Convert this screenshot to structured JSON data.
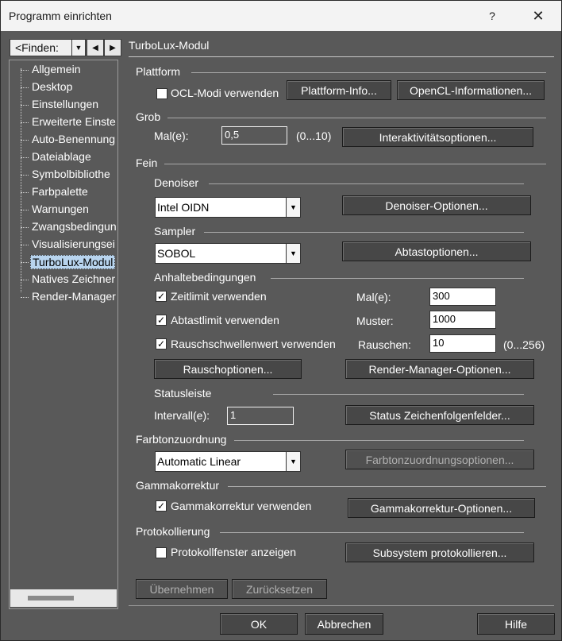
{
  "window": {
    "title": "Programm einrichten",
    "help_glyph": "?",
    "close_glyph": "✕"
  },
  "left": {
    "finder_value": "<Finden:",
    "tree": [
      {
        "label": "Allgemein"
      },
      {
        "label": "Desktop"
      },
      {
        "label": "Einstellungen"
      },
      {
        "label": "Erweiterte Einste"
      },
      {
        "label": "Auto-Benennung"
      },
      {
        "label": "Dateiablage"
      },
      {
        "label": "Symbolbibliothe"
      },
      {
        "label": "Farbpalette"
      },
      {
        "label": "Warnungen"
      },
      {
        "label": "Zwangsbedingun"
      },
      {
        "label": "Visualisierungsei"
      },
      {
        "label": "TurboLux-Modul",
        "selected": true
      },
      {
        "label": "Natives Zeichner"
      },
      {
        "label": "Render-Manager"
      }
    ]
  },
  "panel": {
    "title": "TurboLux-Modul",
    "plattform": {
      "heading": "Plattform",
      "ocl_checkbox": {
        "label": "OCL-Modi verwenden",
        "checked": false
      },
      "platform_info_btn": "Plattform-Info...",
      "opencl_info_btn": "OpenCL-Informationen..."
    },
    "grob": {
      "heading": "Grob",
      "mal_label": "Mal(e):",
      "mal_value": "0,5",
      "range": "(0...10)",
      "interact_btn": "Interaktivitätsoptionen..."
    },
    "fein": {
      "heading": "Fein",
      "denoiser": {
        "heading": "Denoiser",
        "value": "Intel OIDN",
        "options_btn": "Denoiser-Optionen..."
      },
      "sampler": {
        "heading": "Sampler",
        "value": "SOBOL",
        "options_btn": "Abtastoptionen..."
      },
      "halt": {
        "heading": "Anhaltebedingungen",
        "timelimit": {
          "label": "Zeitlimit verwenden",
          "checked": true
        },
        "samplelimit": {
          "label": "Abtastlimit verwenden",
          "checked": true
        },
        "noise": {
          "label": "Rauschschwellenwert verwenden",
          "checked": true
        },
        "mal_label": "Mal(e):",
        "mal_value": "300",
        "muster_label": "Muster:",
        "muster_value": "1000",
        "rauschen_label": "Rauschen:",
        "rauschen_value": "10",
        "rauschen_range": "(0...256)",
        "noise_btn": "Rauschoptionen...",
        "rm_btn": "Render-Manager-Optionen..."
      },
      "status": {
        "heading": "Statusleiste",
        "interval_label": "Intervall(e):",
        "interval_value": "1",
        "fields_btn": "Status Zeichenfolgenfelder..."
      }
    },
    "tone": {
      "heading": "Farbtonzuordnung",
      "value": "Automatic Linear",
      "options_btn": "Farbtonzuordnungsoptionen..."
    },
    "gamma": {
      "heading": "Gammakorrektur",
      "checkbox": {
        "label": "Gammakorrektur verwenden",
        "checked": true
      },
      "options_btn": "Gammakorrektur-Optionen..."
    },
    "log": {
      "heading": "Protokollierung",
      "checkbox": {
        "label": "Protokollfenster anzeigen",
        "checked": false
      },
      "subsystem_btn": "Subsystem protokollieren..."
    },
    "apply_btn": "Übernehmen",
    "reset_btn": "Zurücksetzen"
  },
  "footer": {
    "ok": "OK",
    "cancel": "Abbrechen",
    "help": "Hilfe"
  }
}
